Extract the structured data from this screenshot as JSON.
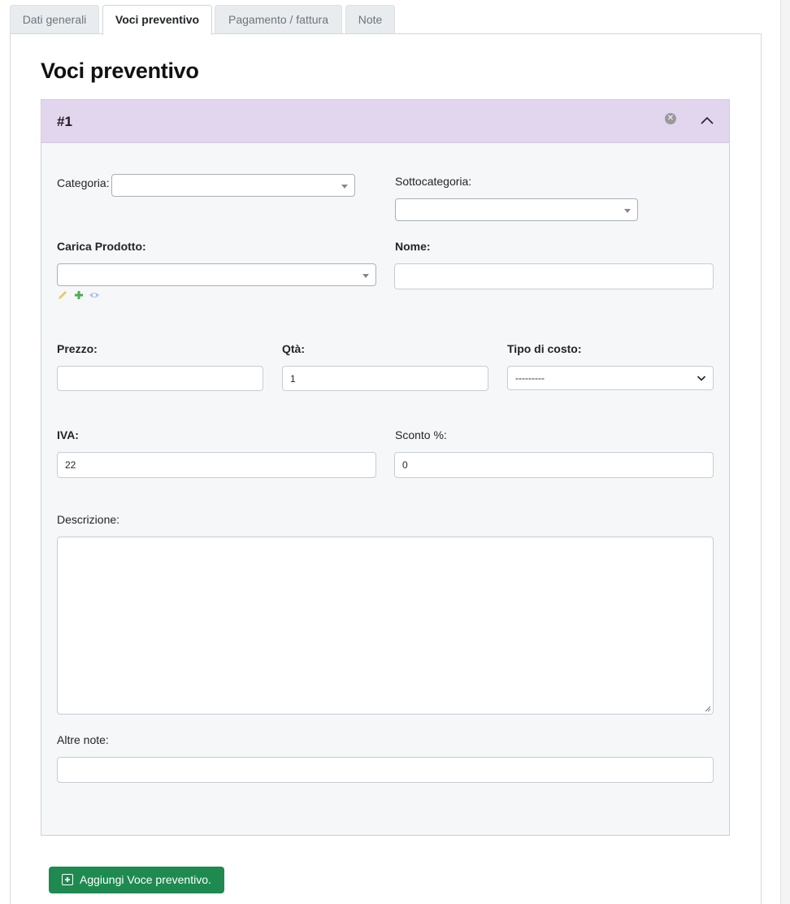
{
  "tabs": [
    {
      "label": "Dati generali",
      "active": false
    },
    {
      "label": "Voci preventivo",
      "active": true
    },
    {
      "label": "Pagamento / fattura",
      "active": false
    },
    {
      "label": "Note",
      "active": false
    }
  ],
  "section": {
    "title": "Voci preventivo"
  },
  "item": {
    "number": "#1",
    "fields": {
      "categoria": {
        "label": "Categoria:",
        "value": ""
      },
      "sottocategoria": {
        "label": "Sottocategoria:",
        "value": ""
      },
      "carica_prodotto": {
        "label": "Carica Prodotto:",
        "value": ""
      },
      "nome": {
        "label": "Nome:",
        "value": ""
      },
      "prezzo": {
        "label": "Prezzo:",
        "value": ""
      },
      "qta": {
        "label": "Qtà:",
        "value": "1"
      },
      "tipo_di_costo": {
        "label": "Tipo di costo:",
        "value": "---------"
      },
      "iva": {
        "label": "IVA:",
        "value": "22"
      },
      "sconto": {
        "label": "Sconto %:",
        "value": "0"
      },
      "descrizione": {
        "label": "Descrizione:",
        "value": ""
      },
      "altre_note": {
        "label": "Altre note:",
        "value": ""
      }
    },
    "product_icons": [
      "pencil-icon",
      "plus-icon",
      "eye-icon"
    ]
  },
  "actions": {
    "add_label": "Aggiungi Voce preventivo."
  },
  "colors": {
    "header_bg": "#e2d6ef",
    "card_bg": "#f6f7f9",
    "add_button": "#1e8a50",
    "plus_icon": "#4caf50",
    "pencil_icon": "#e8c96a",
    "eye_icon": "#a9c6e4"
  }
}
